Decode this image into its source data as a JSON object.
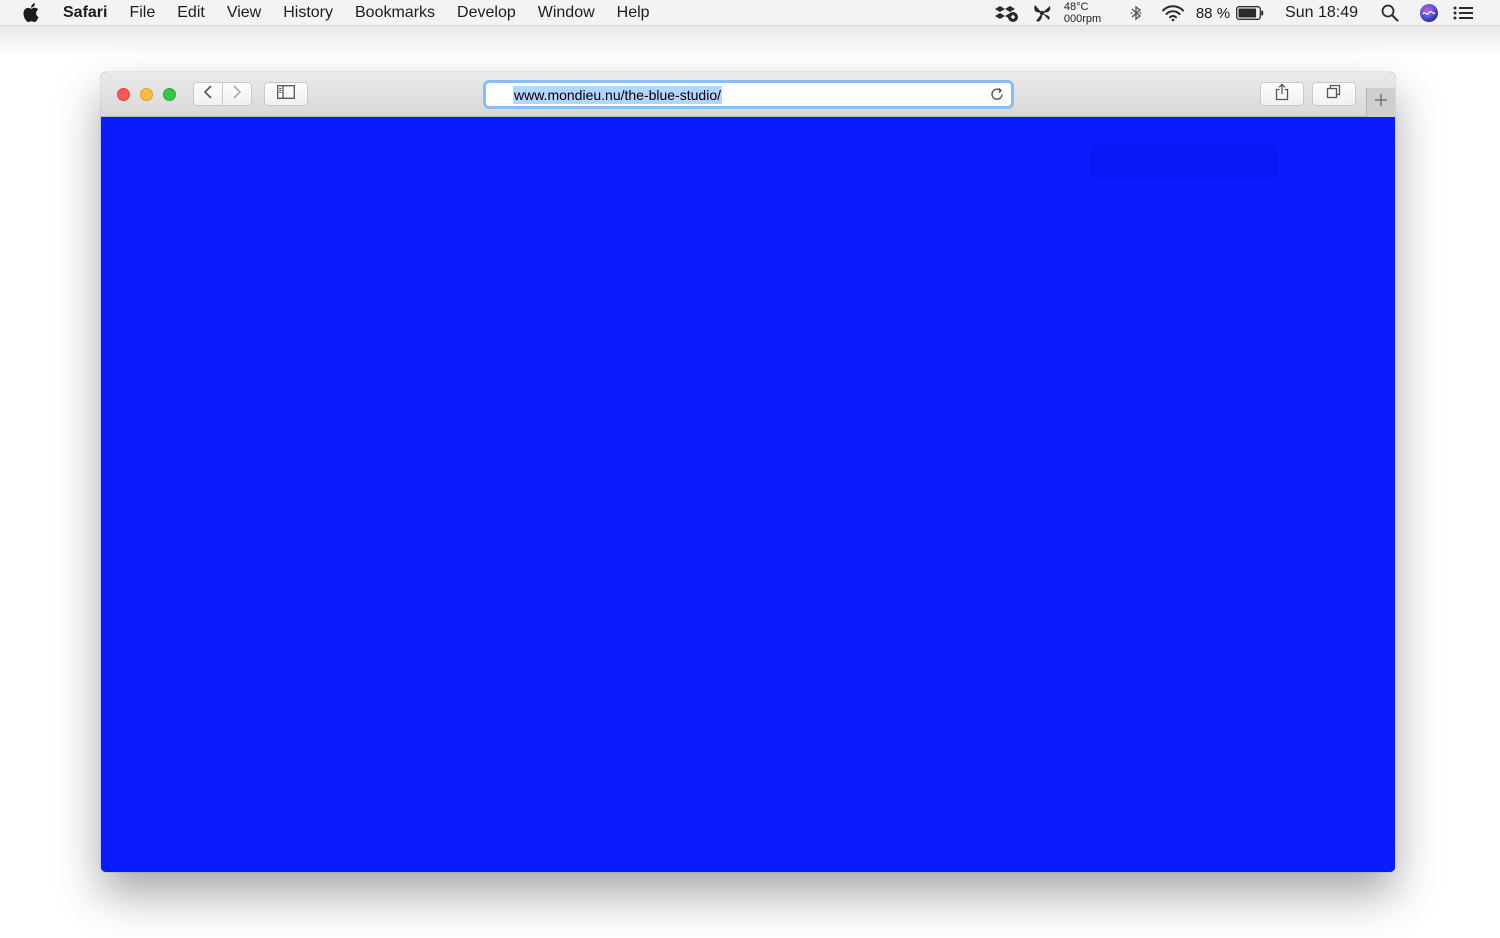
{
  "menubar": {
    "app_name": "Safari",
    "items": [
      "File",
      "Edit",
      "View",
      "History",
      "Bookmarks",
      "Develop",
      "Window",
      "Help"
    ],
    "status": {
      "temperature": "48°C",
      "fan_speed": "000rpm",
      "battery_percent": "88 %",
      "battery_level": 0.88,
      "clock": "Sun 18:49"
    },
    "icons": [
      "apple-icon",
      "dropbox-icon",
      "fan-control-icon",
      "bluetooth-icon",
      "wifi-icon",
      "battery-icon",
      "spotlight-search-icon",
      "siri-icon",
      "notification-center-icon"
    ]
  },
  "browser": {
    "url": "www.mondieu.nu/the-blue-studio/",
    "page_background": "#0a1cff",
    "toolbar_icons": [
      "back-icon",
      "forward-icon",
      "sidebar-icon",
      "reload-icon",
      "share-icon",
      "tabs-overview-icon",
      "new-tab-icon"
    ]
  }
}
